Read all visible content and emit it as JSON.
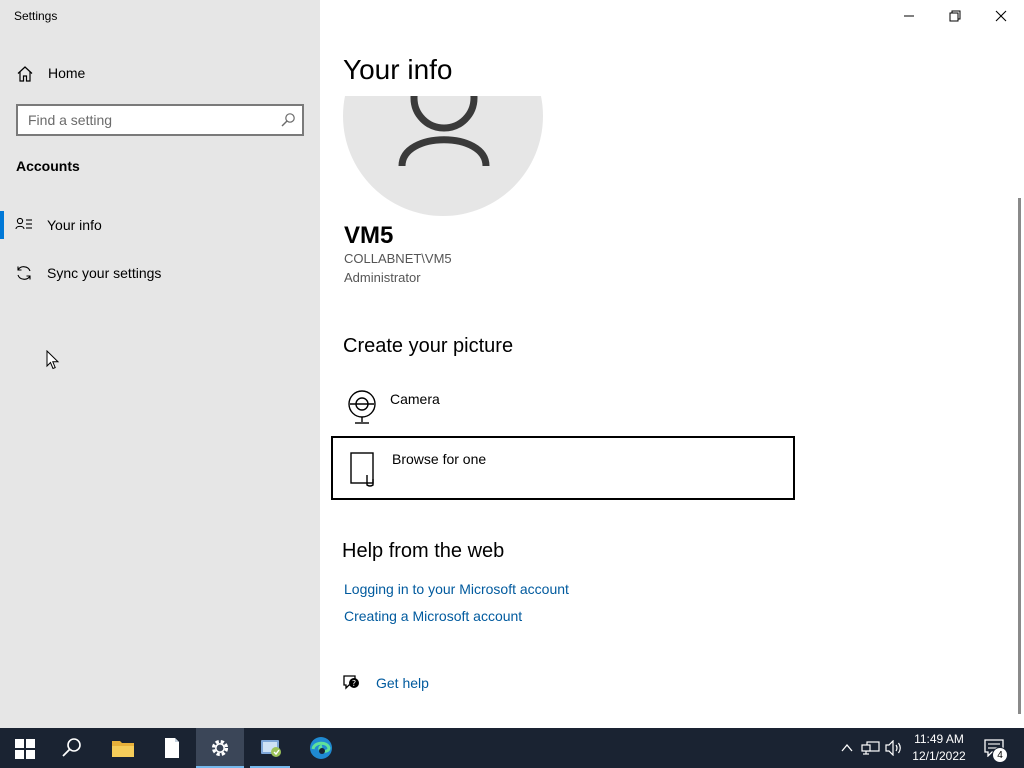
{
  "window": {
    "app_title": "Settings"
  },
  "sidebar": {
    "home_label": "Home",
    "search_placeholder": "Find a setting",
    "section_title": "Accounts",
    "items": [
      {
        "label": "Your info",
        "active": true,
        "icon": "person-list-icon"
      },
      {
        "label": "Sync your settings",
        "active": false,
        "icon": "sync-icon"
      }
    ]
  },
  "main": {
    "page_title": "Your info",
    "user": {
      "name": "VM5",
      "account": "COLLABNET\\VM5",
      "role": "Administrator"
    },
    "create_picture": {
      "heading": "Create your picture",
      "options": [
        {
          "label": "Camera",
          "icon": "webcam-icon"
        },
        {
          "label": "Browse for one",
          "icon": "document-icon"
        }
      ]
    },
    "help": {
      "heading": "Help from the web",
      "links": [
        "Logging in to your Microsoft account",
        "Creating a Microsoft account"
      ],
      "get_help_label": "Get help"
    }
  },
  "taskbar": {
    "apps": [
      "start",
      "search",
      "file-explorer",
      "notepad",
      "settings",
      "control-panel",
      "edge"
    ],
    "active_app": "settings",
    "clock": {
      "time": "11:49 AM",
      "date": "12/1/2022"
    },
    "notification_count": "4"
  },
  "colors": {
    "accent": "#0078d7",
    "link": "#005a9e",
    "sidebar_bg": "#e6e6e6",
    "taskbar_bg": "#1a2332"
  }
}
